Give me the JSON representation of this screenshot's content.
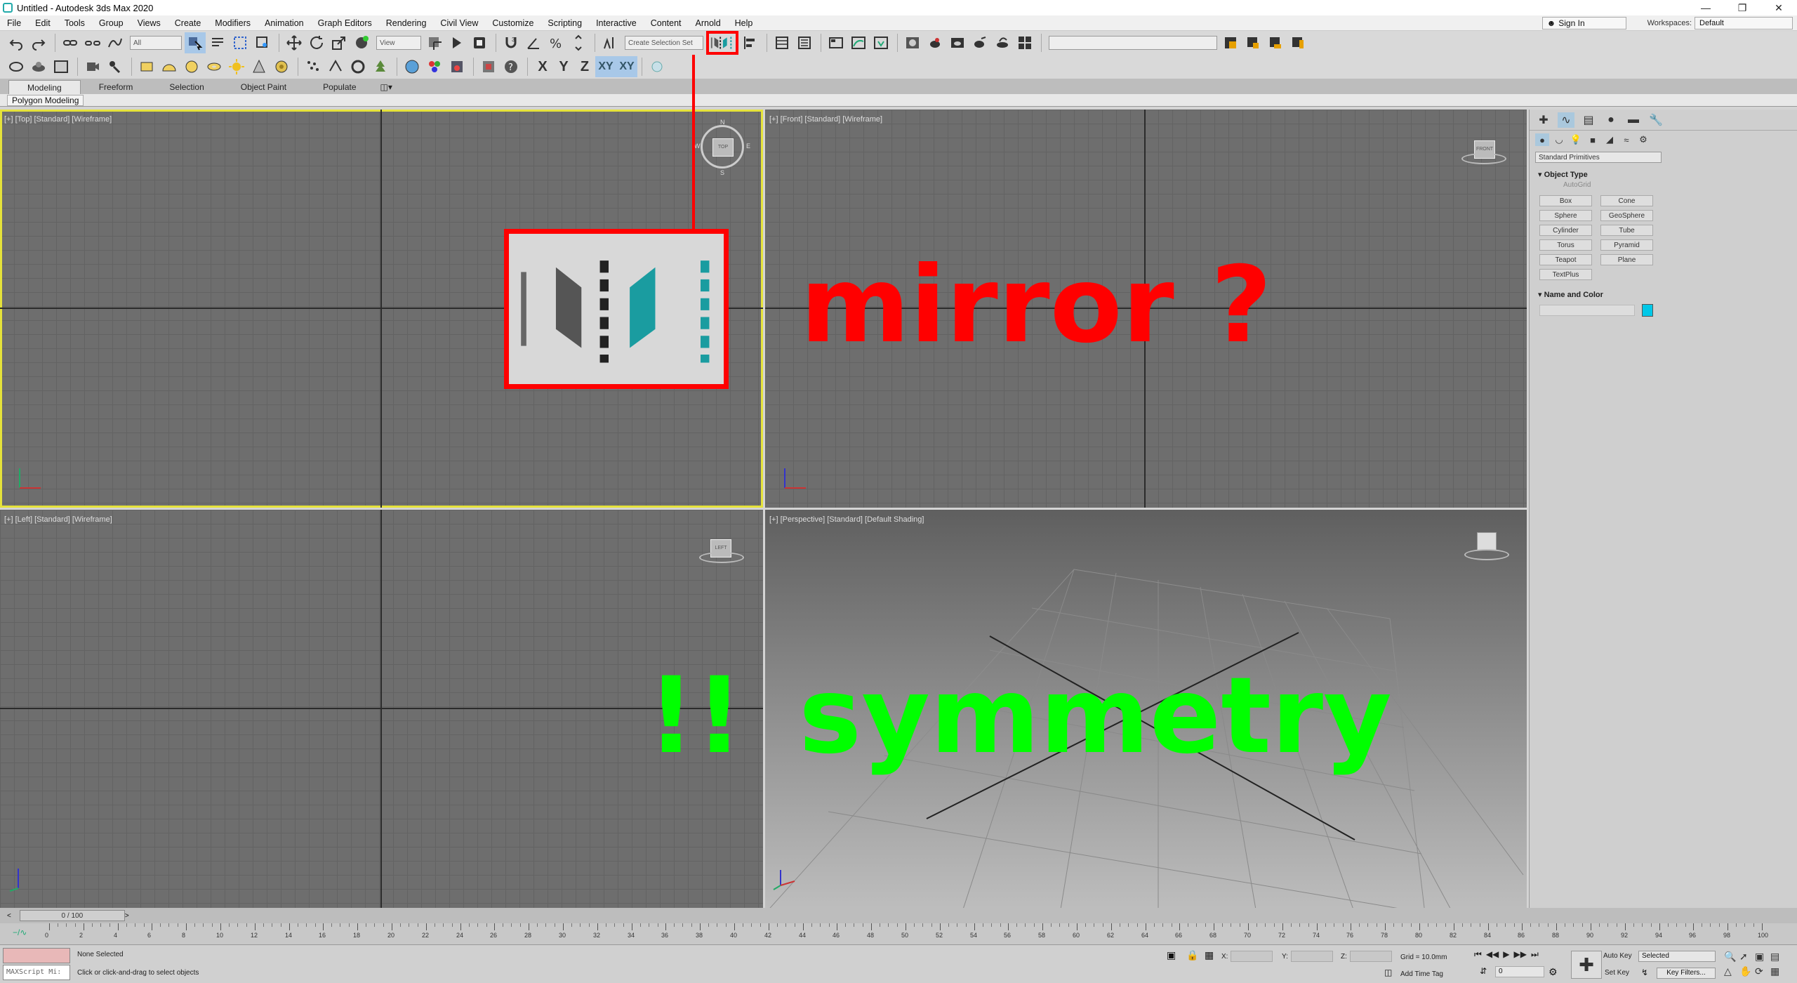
{
  "window": {
    "title": "Untitled - Autodesk 3ds Max 2020",
    "controls": [
      "—",
      "❐",
      "✕"
    ]
  },
  "menu": {
    "items": [
      "File",
      "Edit",
      "Tools",
      "Group",
      "Views",
      "Create",
      "Modifiers",
      "Animation",
      "Graph Editors",
      "Rendering",
      "Civil View",
      "Customize",
      "Scripting",
      "Interactive",
      "Content",
      "Arnold",
      "Help"
    ],
    "sign_in": "Sign In",
    "workspaces_label": "Workspaces:",
    "workspaces_value": "Default"
  },
  "toolbar": {
    "filter": "All",
    "ref_coord": "View",
    "named_selection": "Create Selection Set",
    "axes": [
      "X",
      "Y",
      "Z",
      "XY",
      "XY"
    ]
  },
  "ribbon": {
    "tabs": [
      "Modeling",
      "Freeform",
      "Selection",
      "Object Paint",
      "Populate"
    ],
    "active_tab": "Modeling",
    "sub_label": "Polygon Modeling"
  },
  "viewports": {
    "top": "[+] [Top] [Standard] [Wireframe]",
    "front": "[+] [Front] [Standard] [Wireframe]",
    "left": "[+] [Left] [Standard] [Wireframe]",
    "perspective": "[+] [Perspective] [Standard] [Default Shading]"
  },
  "viewcube": {
    "top": "TOP",
    "front": "FRONT",
    "left": "LEFT",
    "compass": [
      "N",
      "E",
      "S",
      "W"
    ]
  },
  "annotations": {
    "mirror": "mirror ?",
    "exclaim": "!!",
    "symmetry": "symmetry",
    "mirror_color": "#ff0000",
    "symmetry_color": "#00ff00"
  },
  "command_panel": {
    "category": "Standard Primitives",
    "object_type_title": "Object Type",
    "autogrid": "AutoGrid",
    "buttons": [
      "Box",
      "Cone",
      "Sphere",
      "GeoSphere",
      "Cylinder",
      "Tube",
      "Torus",
      "Pyramid",
      "Teapot",
      "Plane",
      "TextPlus"
    ],
    "name_color_title": "Name and Color",
    "object_color": "#00c8e8"
  },
  "timeline": {
    "slider_value": "0 / 100",
    "ticks": [
      "0",
      "2",
      "4",
      "6",
      "8",
      "10",
      "12",
      "14",
      "16",
      "18",
      "20",
      "22",
      "24",
      "26",
      "28",
      "30",
      "32",
      "34",
      "36",
      "38",
      "40",
      "42",
      "44",
      "46",
      "48",
      "50",
      "52",
      "54",
      "56",
      "58",
      "60",
      "62",
      "64",
      "66",
      "68",
      "70",
      "72",
      "74",
      "76",
      "78",
      "80",
      "82",
      "84",
      "86",
      "88",
      "90",
      "92",
      "94",
      "96",
      "98",
      "100"
    ]
  },
  "status": {
    "maxscript": "MAXScript Mi:",
    "selection": "None Selected",
    "prompt": "Click or click-and-drag to select objects",
    "x_label": "X:",
    "y_label": "Y:",
    "z_label": "Z:",
    "grid": "Grid = 10.0mm",
    "add_time_tag": "Add Time Tag",
    "frame": "0",
    "auto_key": "Auto Key",
    "set_key": "Set Key",
    "selected": "Selected",
    "key_filters": "Key Filters..."
  }
}
